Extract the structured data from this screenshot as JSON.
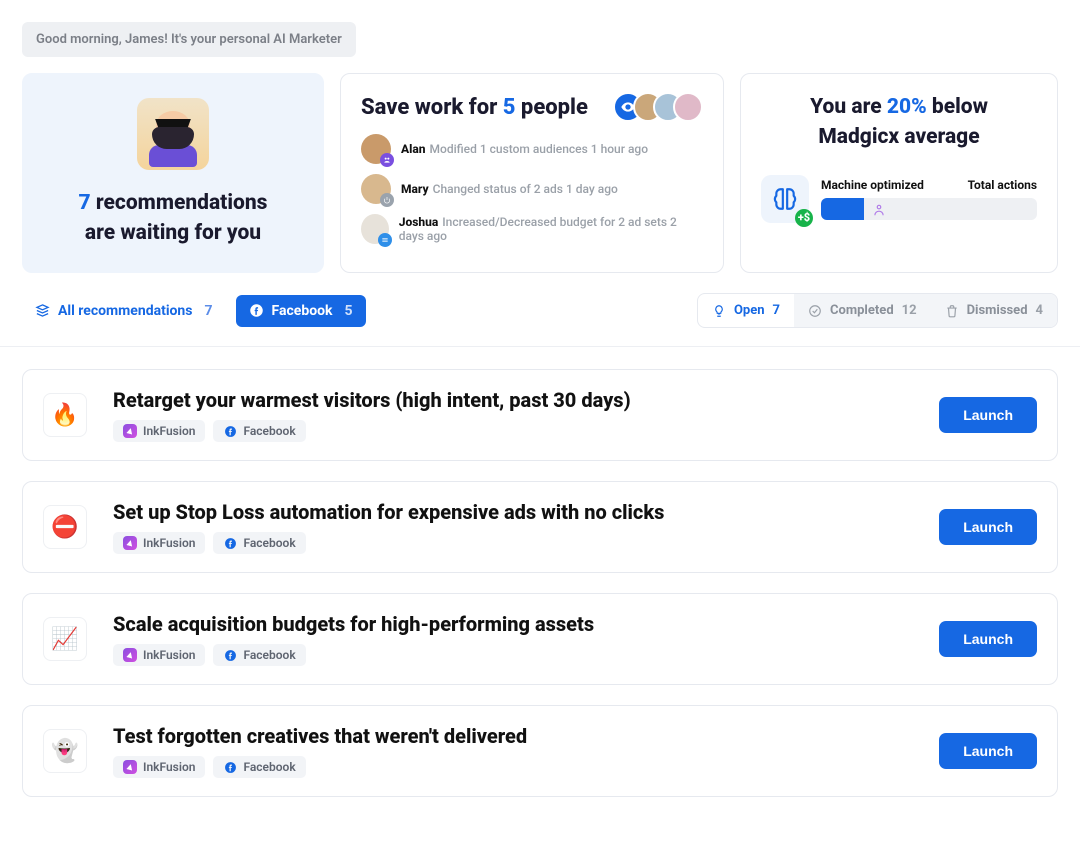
{
  "greeting": "Good morning, James! It's your personal AI Marketer",
  "hero_card": {
    "count": "7",
    "line1_prefix": "",
    "line1_suffix": " recommendations",
    "line2": "are waiting for you"
  },
  "save_work": {
    "title_prefix": "Save work for ",
    "count": "5",
    "title_suffix": " people",
    "activities": [
      {
        "name": "Alan",
        "desc": "Modified 1 custom audiences 1 hour ago"
      },
      {
        "name": "Mary",
        "desc": "Changed status of 2 ads 1 day ago"
      },
      {
        "name": "Joshua",
        "desc": "Increased/Decreased budget for 2 ad sets 2 days ago"
      }
    ]
  },
  "benchmark": {
    "line1_prefix": "You are ",
    "percent": "20%",
    "line1_suffix": " below",
    "line2": "Madgicx average",
    "label_left": "Machine optimized",
    "label_right": "Total actions",
    "plus_badge": "+$"
  },
  "filters_left": {
    "all_label": "All recommendations",
    "all_count": "7",
    "fb_label": "Facebook",
    "fb_count": "5"
  },
  "filters_right": {
    "open_label": "Open",
    "open_count": "7",
    "completed_label": "Completed",
    "completed_count": "12",
    "dismissed_label": "Dismissed",
    "dismissed_count": "4"
  },
  "tags": {
    "ink": "InkFusion",
    "fb": "Facebook"
  },
  "launch_label": "Launch",
  "recommendations": [
    {
      "emoji": "🔥",
      "title": "Retarget your warmest visitors (high intent, past 30 days)"
    },
    {
      "emoji": "⛔",
      "title": "Set up Stop Loss automation for expensive ads with no clicks"
    },
    {
      "emoji": "📈",
      "title": "Scale acquisition budgets for high-performing assets"
    },
    {
      "emoji": "👻",
      "title": "Test forgotten creatives that weren't delivered"
    }
  ]
}
